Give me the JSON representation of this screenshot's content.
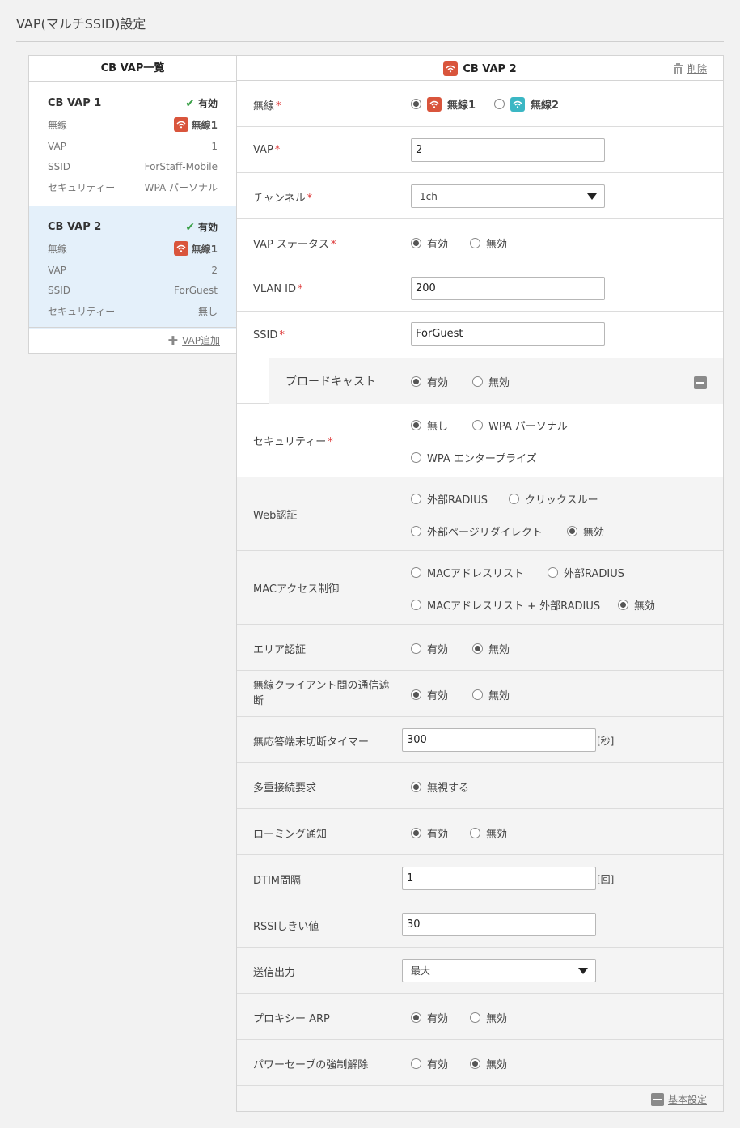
{
  "page_title": "VAP(マルチSSID)設定",
  "left": {
    "header": "CB VAP一覧",
    "cards": [
      {
        "title": "CB VAP 1",
        "status": "有効",
        "wireless_label": "無線",
        "wireless_value": "無線1",
        "vap_label": "VAP",
        "vap_value": "1",
        "ssid_label": "SSID",
        "ssid_value": "ForStaff-Mobile",
        "security_label": "セキュリティー",
        "security_value": "WPA パーソナル"
      },
      {
        "title": "CB VAP 2",
        "status": "有効",
        "wireless_label": "無線",
        "wireless_value": "無線1",
        "vap_label": "VAP",
        "vap_value": "2",
        "ssid_label": "SSID",
        "ssid_value": "ForGuest",
        "security_label": "セキュリティー",
        "security_value": "無し"
      }
    ],
    "add_link": "VAP追加"
  },
  "right": {
    "title": "CB VAP 2",
    "delete_link": "削除",
    "wireless": {
      "label": "無線",
      "opt1": "無線1",
      "opt2": "無線2",
      "selected": "無線1"
    },
    "vap": {
      "label": "VAP",
      "value": "2"
    },
    "channel": {
      "label": "チャンネル",
      "value": "1ch"
    },
    "vap_status": {
      "label": "VAP ステータス",
      "opt_on": "有効",
      "opt_off": "無効",
      "selected": "有効"
    },
    "vlan": {
      "label": "VLAN ID",
      "value": "200"
    },
    "ssid": {
      "label": "SSID",
      "value": "ForGuest"
    },
    "broadcast": {
      "label": "ブロードキャスト",
      "opt_on": "有効",
      "opt_off": "無効",
      "selected": "有効"
    },
    "security": {
      "label": "セキュリティー",
      "opt1": "無し",
      "opt2": "WPA パーソナル",
      "opt3": "WPA エンタープライズ",
      "selected": "無し"
    },
    "web_auth": {
      "label": "Web認証",
      "opt1": "外部RADIUS",
      "opt2": "クリックスルー",
      "opt3": "外部ページリダイレクト",
      "opt4": "無効",
      "selected": "無効"
    },
    "mac_access": {
      "label": "MACアクセス制御",
      "opt1": "MACアドレスリスト",
      "opt2": "外部RADIUS",
      "opt3": "MACアドレスリスト + 外部RADIUS",
      "opt4": "無効",
      "selected": "無効"
    },
    "area_auth": {
      "label": "エリア認証",
      "opt_on": "有効",
      "opt_off": "無効",
      "selected": "無効"
    },
    "client_isolation": {
      "label": "無線クライアント間の通信遮断",
      "opt_on": "有効",
      "opt_off": "無効",
      "selected": "有効"
    },
    "idle_timer": {
      "label": "無応答端末切断タイマー",
      "value": "300",
      "unit": "[秒]"
    },
    "multi_conn": {
      "label": "多重接続要求",
      "opt1": "無視する",
      "selected": "無視する"
    },
    "roaming": {
      "label": "ローミング通知",
      "opt_on": "有効",
      "opt_off": "無効",
      "selected": "有効"
    },
    "dtim": {
      "label": "DTIM間隔",
      "value": "1",
      "unit": "[回]"
    },
    "rssi": {
      "label": "RSSIしきい値",
      "value": "30"
    },
    "tx_power": {
      "label": "送信出力",
      "value": "最大"
    },
    "proxy_arp": {
      "label": "プロキシー ARP",
      "opt_on": "有効",
      "opt_off": "無効",
      "selected": "有効"
    },
    "power_save": {
      "label": "パワーセーブの強制解除",
      "opt_on": "有効",
      "opt_off": "無効",
      "selected": "無効"
    },
    "basic_settings_link": "基本設定"
  },
  "colors": {
    "wifi1": "#d9553c",
    "wifi2": "#3bb7c4",
    "selected_card": "#e4f0fa",
    "required": "#dd3333",
    "ok_check": "#3aa048"
  }
}
